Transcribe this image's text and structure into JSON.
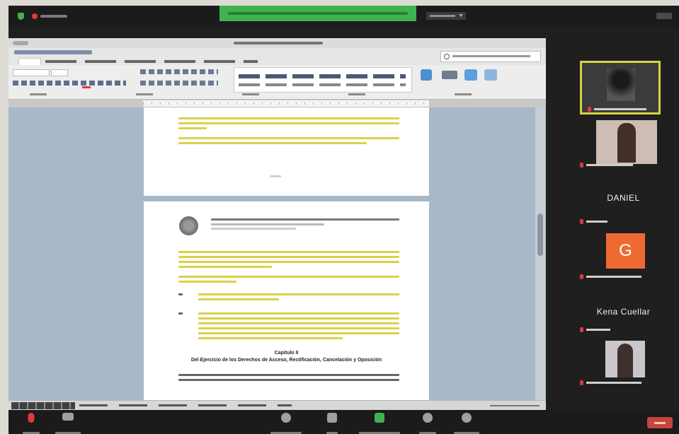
{
  "participants": [
    {
      "name": "DANIEL"
    },
    {
      "name": "Kena Cuellar"
    },
    {
      "initial": "G"
    }
  ],
  "heading": {
    "capitulo": "Capitulo II",
    "titulo": "Del Ejercicio de los Derechos de Acceso, Rectificación, Cancelación y Oposición"
  },
  "colors": {
    "zoom_bg": "#1f1f1f",
    "share_banner": "#3fb34f",
    "active_speaker_border": "#d6d33f",
    "avatar_g": "#ed6b32",
    "highlight": "#d9d24a",
    "ribbon": "#e3e3e3",
    "document_bg": "#a7b9c8",
    "leave_button": "#c4453c"
  },
  "icons": [
    "shield-icon",
    "microphone-icon",
    "video-icon",
    "participants-icon",
    "chat-icon",
    "share-screen-icon",
    "record-icon",
    "reactions-icon",
    "view-icon"
  ]
}
